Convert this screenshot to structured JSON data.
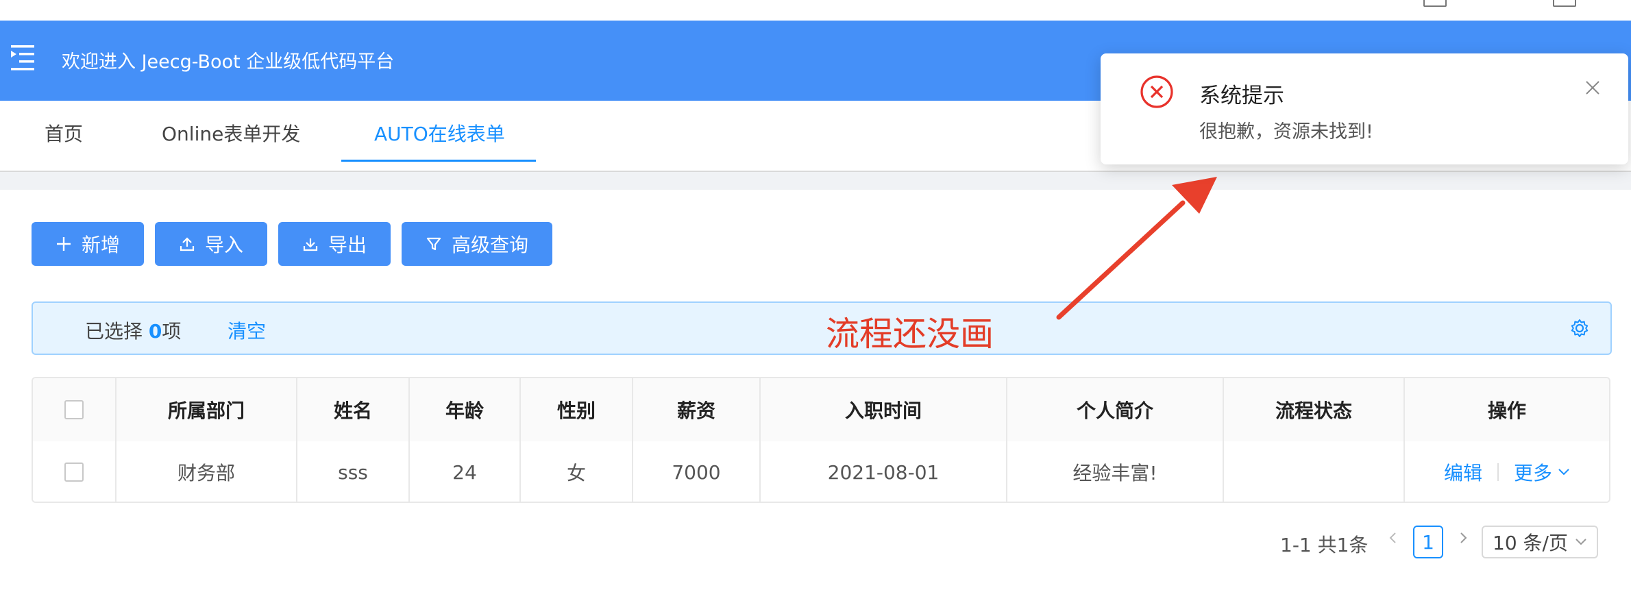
{
  "header": {
    "title": "欢迎进入 Jeecg-Boot 企业级低代码平台"
  },
  "tabs": [
    {
      "label": "首页"
    },
    {
      "label": "Online表单开发"
    },
    {
      "label": "AUTO在线表单"
    }
  ],
  "toolbar": {
    "add_label": "新增",
    "import_label": "导入",
    "export_label": "导出",
    "query_label": "高级查询"
  },
  "selection": {
    "prefix": "已选择 ",
    "count": "0",
    "suffix": "项",
    "clear_label": "清空"
  },
  "annotation": "流程还没画",
  "table": {
    "columns": [
      "所属部门",
      "姓名",
      "年龄",
      "性别",
      "薪资",
      "入职时间",
      "个人简介",
      "流程状态",
      "操作"
    ],
    "rows": [
      {
        "dept": "财务部",
        "name": "sss",
        "age": "24",
        "gender": "女",
        "salary": "7000",
        "hire_date": "2021-08-01",
        "intro": "经验丰富!",
        "flow_status": "",
        "edit": "编辑",
        "more": "更多"
      }
    ]
  },
  "pagination": {
    "total_text": "1-1 共1条",
    "current_page": "1",
    "page_size": "10 条/页"
  },
  "notification": {
    "title": "系统提示",
    "message": "很抱歉，资源未找到!"
  },
  "colors": {
    "primary": "#4590f8",
    "link": "#1890ff",
    "error": "#e8322b",
    "annotation": "#e33c27"
  }
}
